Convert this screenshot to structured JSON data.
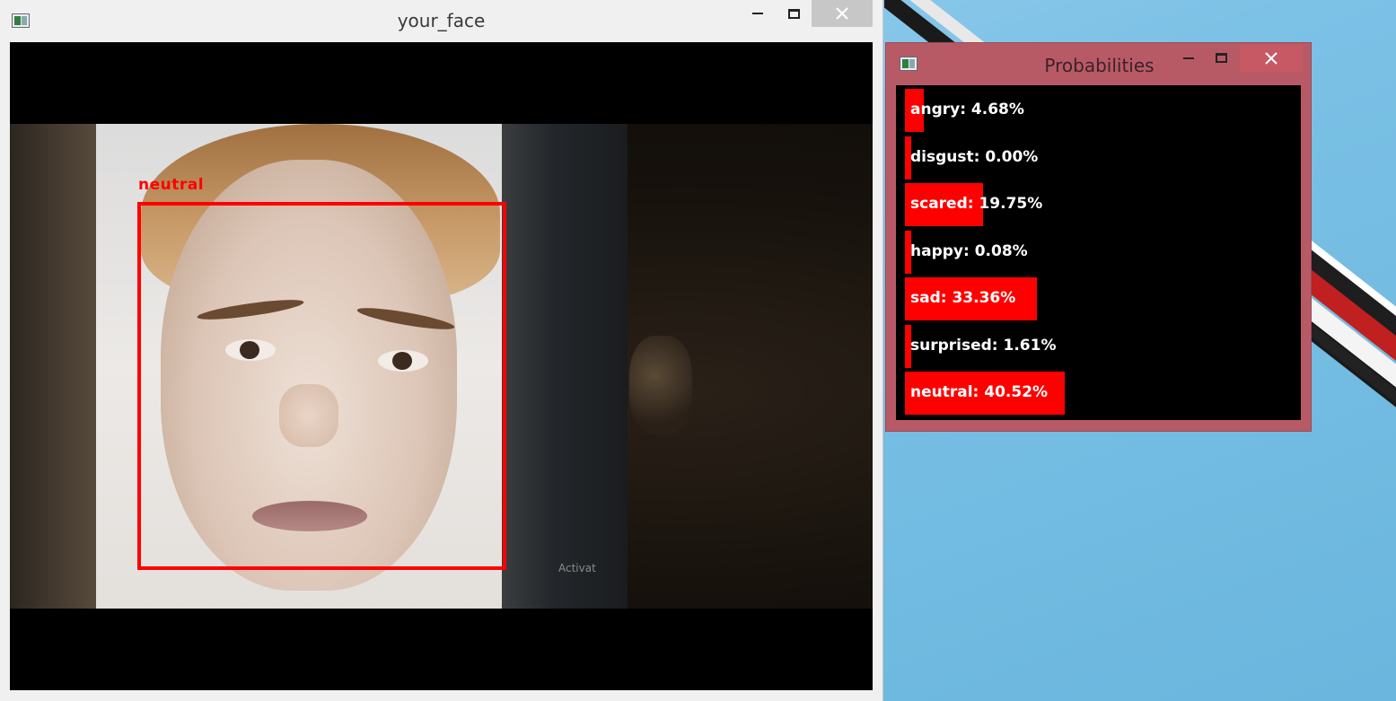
{
  "face_window": {
    "title": "your_face",
    "detection_label": "neutral",
    "watermark_text": "Activat",
    "label_color": "#ff0000"
  },
  "prob_window": {
    "title": "Probabilities",
    "bar_color": "#ff0000",
    "rows": [
      {
        "text": "angry: 4.68%",
        "value": 4.68
      },
      {
        "text": "disgust: 0.00%",
        "value": 0.0
      },
      {
        "text": "scared: 19.75%",
        "value": 19.75
      },
      {
        "text": "happy: 0.08%",
        "value": 0.08
      },
      {
        "text": "sad: 33.36%",
        "value": 33.36
      },
      {
        "text": "surprised: 1.61%",
        "value": 1.61
      },
      {
        "text": "neutral: 40.52%",
        "value": 40.52
      }
    ]
  },
  "icons": {
    "minimize": "minimize-icon",
    "maximize": "maximize-icon",
    "close": "close-icon",
    "app": "app-icon"
  }
}
